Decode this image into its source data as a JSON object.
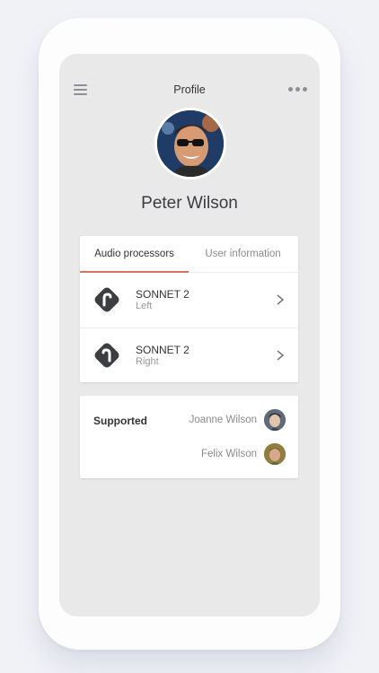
{
  "header": {
    "title": "Profile",
    "menu_icon": "hamburger-menu-icon",
    "more_icon": "more-horizontal-icon"
  },
  "profile": {
    "name": "Peter Wilson"
  },
  "tabs": [
    {
      "label": "Audio processors",
      "active": true
    },
    {
      "label": "User information",
      "active": false
    }
  ],
  "processors": [
    {
      "name": "SONNET 2",
      "side": "Left",
      "icon": "processor-icon"
    },
    {
      "name": "SONNET 2",
      "side": "Right",
      "icon": "processor-icon"
    }
  ],
  "supported": {
    "label": "Supported",
    "people": [
      {
        "name": "Joanne Wilson"
      },
      {
        "name": "Felix Wilson"
      }
    ]
  },
  "colors": {
    "accent": "#d9735f",
    "screen_bg": "#e9e9ea",
    "icon_dark": "#3d3e42"
  }
}
